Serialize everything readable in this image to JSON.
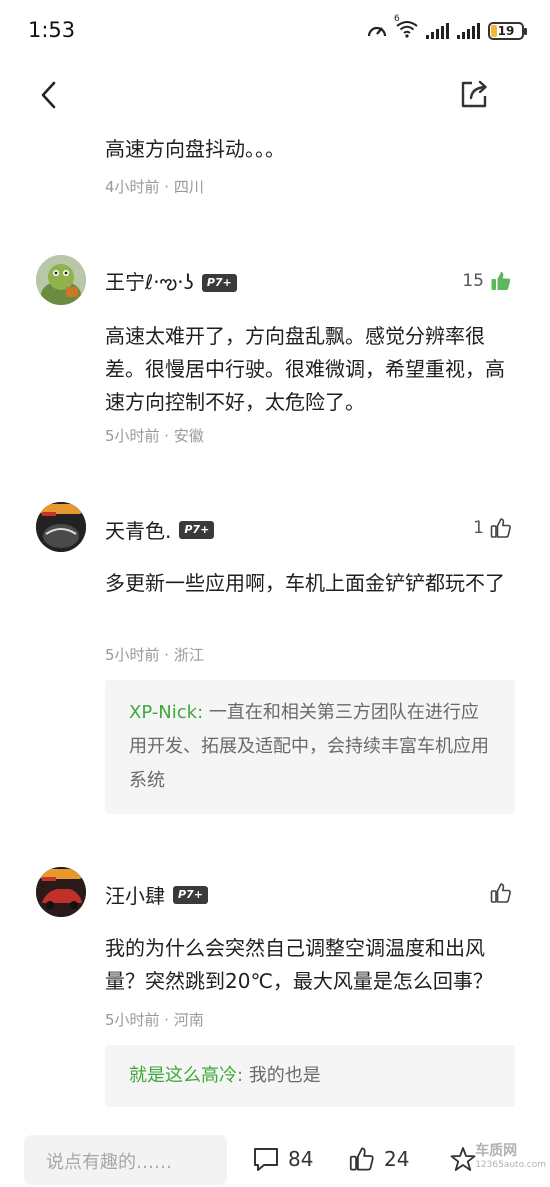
{
  "status_bar": {
    "time": "1:53",
    "battery": "19",
    "battery_level": 0.19,
    "wifi_label": "6"
  },
  "comments": [
    {
      "text": "高速方向盘抖动。。。",
      "meta": "4小时前 · 四川"
    },
    {
      "username": "王宁ℓ·ఌ·ʖ",
      "badge": "P7+",
      "likes": "15",
      "liked": true,
      "text": "高速太难开了，方向盘乱飘。感觉分辨率很差。很慢居中行驶。很难微调，希望重视，高速方向控制不好，太危险了。",
      "meta": "5小时前 · 安徽"
    },
    {
      "username": "天青色.",
      "badge": "P7+",
      "likes": "1",
      "liked": false,
      "text": "多更新一些应用啊，车机上面金铲铲都玩不了",
      "meta": "5小时前 · 浙江",
      "reply": {
        "name": "XP-Nick:",
        "text": "一直在和相关第三方团队在进行应用开发、拓展及适配中，会持续丰富车机应用系统"
      }
    },
    {
      "username": "汪小肆",
      "badge": "P7+",
      "likes": "",
      "liked": false,
      "text": "我的为什么会突然自己调整空调温度和出风量？突然跳到20℃，最大风量是怎么回事？",
      "meta": "5小时前 · 河南",
      "reply": {
        "name": "就是这么高冷:",
        "text": "我的也是"
      }
    }
  ],
  "bottom_bar": {
    "input_placeholder": "说点有趣的……",
    "comment_count": "84",
    "like_count": "24"
  },
  "watermark": {
    "brand": "车质网",
    "url": "12365auto.com"
  },
  "colors": {
    "accent_green": "#3fa83a",
    "reply_bg": "#f5f5f5",
    "meta_gray": "#9a9a9a"
  }
}
